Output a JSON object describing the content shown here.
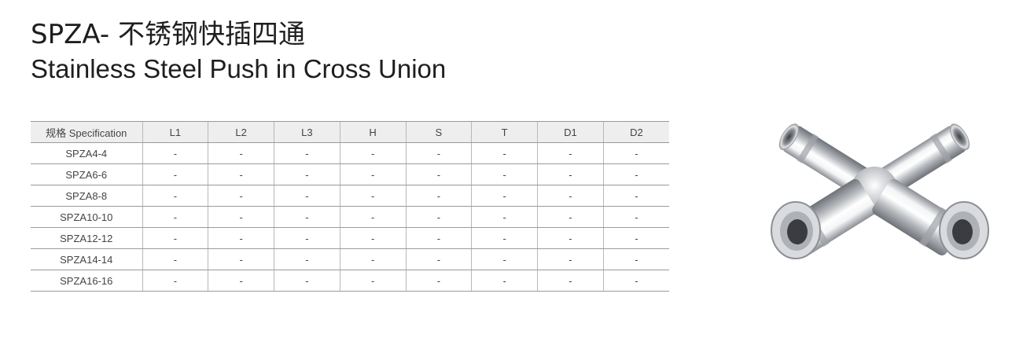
{
  "title_cn": "SPZA- 不锈钢快插四通",
  "title_en": "Stainless Steel Push in Cross Union",
  "table": {
    "headers": [
      "规格 Specification",
      "L1",
      "L2",
      "L3",
      "H",
      "S",
      "T",
      "D1",
      "D2"
    ],
    "rows": [
      [
        "SPZA4-4",
        "-",
        "-",
        "-",
        "-",
        "-",
        "-",
        "-",
        "-"
      ],
      [
        "SPZA6-6",
        "-",
        "-",
        "-",
        "-",
        "-",
        "-",
        "-",
        "-"
      ],
      [
        "SPZA8-8",
        "-",
        "-",
        "-",
        "-",
        "-",
        "-",
        "-",
        "-"
      ],
      [
        "SPZA10-10",
        "-",
        "-",
        "-",
        "-",
        "-",
        "-",
        "-",
        "-"
      ],
      [
        "SPZA12-12",
        "-",
        "-",
        "-",
        "-",
        "-",
        "-",
        "-",
        "-"
      ],
      [
        "SPZA14-14",
        "-",
        "-",
        "-",
        "-",
        "-",
        "-",
        "-",
        "-"
      ],
      [
        "SPZA16-16",
        "-",
        "-",
        "-",
        "-",
        "-",
        "-",
        "-",
        "-"
      ]
    ]
  }
}
